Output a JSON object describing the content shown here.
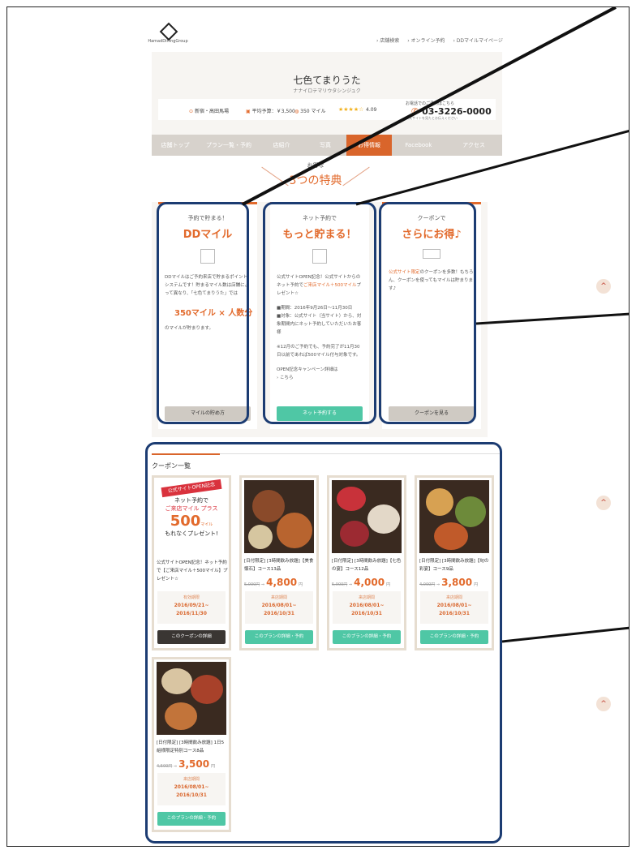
{
  "header": {
    "logo_text": "HamadDiningGroup",
    "links": [
      "› 店舗検索",
      "› オンライン予約",
      "› DDマイルマイページ"
    ]
  },
  "shop": {
    "name": "七色てまりうた",
    "kana": "ナナイロテマリウタシンジュク",
    "location": "新宿・高田馬場",
    "budget": "平均予算：￥3,500",
    "miles": "350 マイル",
    "stars": "★★★★☆",
    "rating": "4.09",
    "tel_note": "お電話でのご予約はこちら",
    "tel": "03-3226-0000",
    "tel_sub": "公式サイトを見たとお伝えください"
  },
  "nav": {
    "tabs": [
      "店舗トップ",
      "プラン一覧・予約",
      "店紹介",
      "写真",
      "お得情報",
      "Facebook",
      "アクセス"
    ],
    "active_index": 4
  },
  "tokuten": {
    "sub": "お得な",
    "main": "3つの特典"
  },
  "cards": [
    {
      "caption": "予約で貯まる！",
      "headline": "DDマイル",
      "body": "DDマイルはご予約来店で貯まるポイントシステムです！貯まるマイル数は店舗によって異なり、「七色てまりうた」では",
      "highlight": "350マイル × 人数分",
      "body2": "のマイルが貯まります。",
      "button": "マイルの貯め方"
    },
    {
      "caption": "ネット予約で",
      "headline": "もっと貯まる！",
      "body": "公式サイトOPEN記念！公式サイトからのネット予約で",
      "body_em": "ご来店マイル＋500マイル",
      "body_tail": "プレゼント☆",
      "period": "■期間：2016年9月26日～11月30日",
      "target": "■対象：公式サイト（当サイト）から、対象期間内にネット予約していただいたお客様",
      "note": "※12月のご予約でも、予約完了が11月30日以前であれば500マイル付与対象です。",
      "campaign": "OPEN記念キャンペーン詳細は",
      "campaign_link": "› こちら",
      "button": "ネット予約する"
    },
    {
      "caption": "クーポンで",
      "headline": "さらにお得♪",
      "body_em": "公式サイト限定",
      "body": "のクーポンを多数！もちろん、クーポンを使ってもマイルは貯まります♪",
      "button": "クーポンを見る"
    }
  ],
  "coupons": {
    "title": "クーポン一覧",
    "items": [
      {
        "banner_ribbon": "公式サイトOPEN記念",
        "banner_l1": "ネット予約で",
        "banner_l2": "ご来店マイル プラス",
        "banner_l3": "500",
        "banner_l3u": "マイル",
        "banner_l4": "もれなくプレゼント!",
        "name": "公式サイトOPEN記念！ネット予約で【ご来店マイル＋500マイル】プレゼント☆",
        "period_label": "有効期限",
        "period": "2016/09/21~\n2016/11/30",
        "button": "このクーポンの詳細"
      },
      {
        "name": "[日付限定] [3時間飲み放題]【美食懐石】コース13品",
        "old_price": "5,000円",
        "price": "4,800",
        "unit": "円",
        "period_label": "来店期間",
        "period": "2016/08/01~\n2016/10/31",
        "button": "このプランの詳細・予約"
      },
      {
        "name": "[日付限定] [3時間飲み放題]【七色の宴】コース12品",
        "old_price": "5,000円",
        "price": "4,000",
        "unit": "円",
        "period_label": "来店期間",
        "period": "2016/08/01~\n2016/10/31",
        "button": "このプランの詳細・予約"
      },
      {
        "name": "[日付限定] [3時間飲み放題]【旬の彩宴】コース9品",
        "old_price": "4,000円",
        "price": "3,800",
        "unit": "円",
        "period_label": "来店期間",
        "period": "2016/08/01~\n2016/10/31",
        "button": "このプランの詳細・予約"
      },
      {
        "name": "[日付限定] [3時間飲み放題] 1日5組様限定特別コース8品",
        "old_price": "4,500円",
        "price": "3,500",
        "unit": "円",
        "period_label": "来店期間",
        "period": "2016/08/01~\n2016/10/31",
        "button": "このプランの詳細・予約"
      }
    ]
  },
  "scroll_up_icon": "^",
  "colors": {
    "accent": "#e26a2c",
    "teal": "#4fc7a5",
    "annotation": "#1c3c72"
  }
}
